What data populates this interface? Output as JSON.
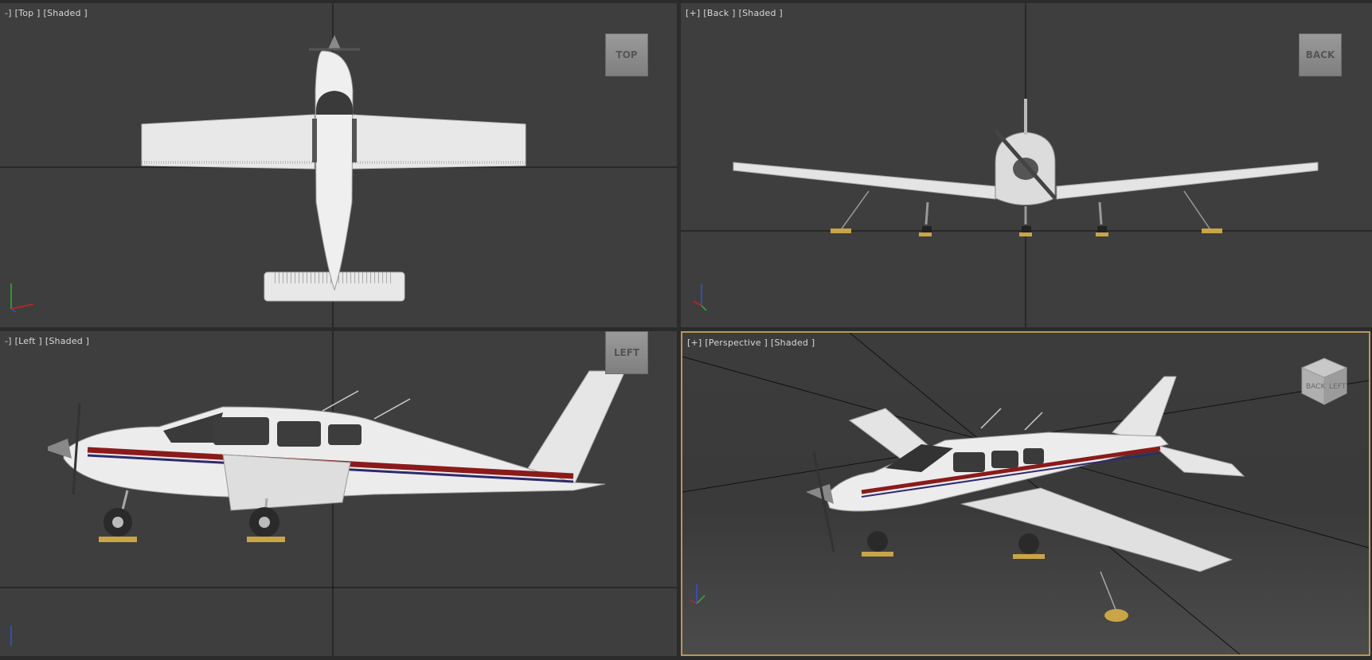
{
  "viewports": {
    "top": {
      "menu": "-]",
      "view": "[Top ]",
      "shading": "[Shaded ]",
      "cube": "TOP"
    },
    "back": {
      "menu": "[+]",
      "view": "[Back ]",
      "shading": "[Shaded ]",
      "cube": "BACK"
    },
    "left": {
      "menu": "-]",
      "view": "[Left ]",
      "shading": "[Shaded ]",
      "cube": "LEFT"
    },
    "perspective": {
      "menu": "[+]",
      "view": "[Perspective ]",
      "shading": "[Shaded ]",
      "cube_faces": [
        "BACK",
        "LEFT"
      ]
    }
  },
  "colors": {
    "viewport_bg": "#3e3e3e",
    "grid_line": "#111111",
    "active_border": "#b59a55",
    "stripe_red": "#8b1a1a",
    "stripe_blue": "#2d2a6e",
    "aircraft_body": "#e6e6e6",
    "axis_x": "#d02020",
    "axis_y": "#30b030",
    "axis_z": "#3050e0"
  },
  "icons": {
    "axis_tripod": "axis-tripod-icon",
    "viewcube": "viewcube-icon"
  }
}
